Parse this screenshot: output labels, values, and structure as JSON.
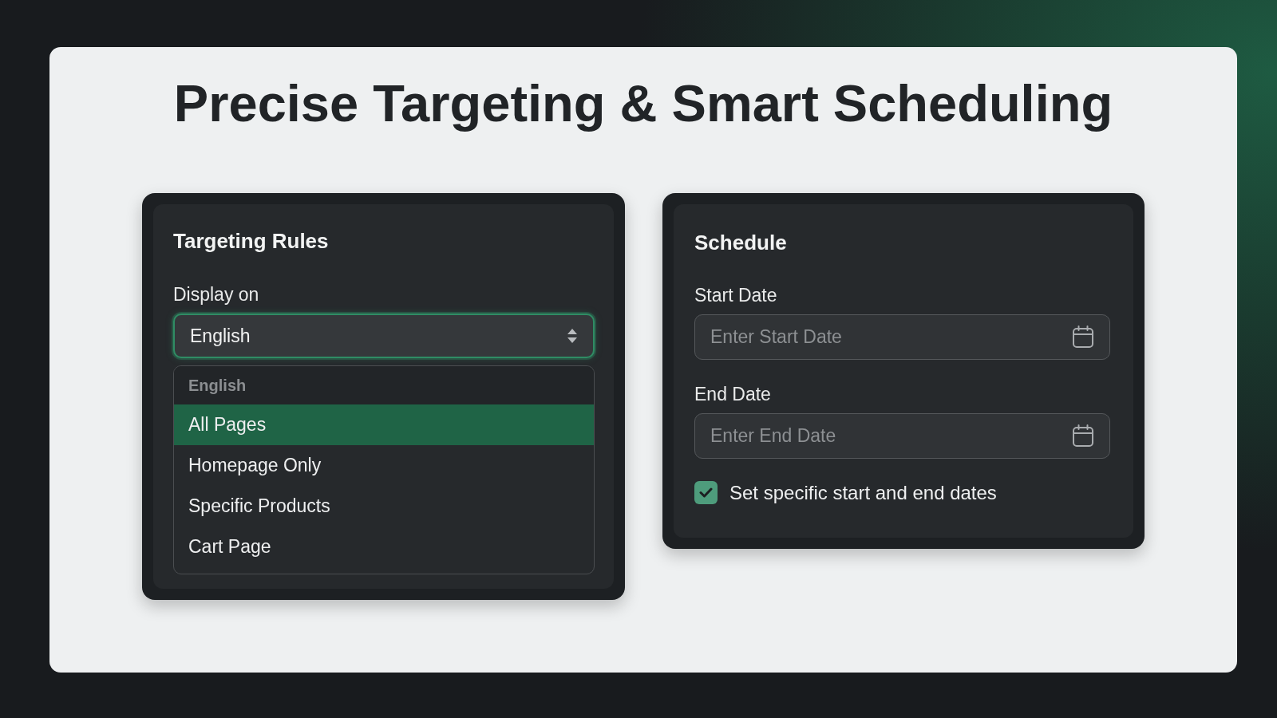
{
  "title": "Precise Targeting & Smart Scheduling",
  "targeting_panel": {
    "heading": "Targeting Rules",
    "label": "Display on",
    "select": {
      "value": "English",
      "expanded": true
    },
    "dropdown": {
      "header": "English",
      "options": [
        {
          "label": "All Pages",
          "selected": true
        },
        {
          "label": "Homepage Only",
          "selected": false
        },
        {
          "label": "Specific Products",
          "selected": false
        },
        {
          "label": "Cart Page",
          "selected": false
        }
      ]
    }
  },
  "schedule_panel": {
    "heading": "Schedule",
    "fields": [
      {
        "label": "Start Date",
        "placeholder": "Enter Start Date"
      },
      {
        "label": "End Date",
        "placeholder": "Enter End Date"
      }
    ],
    "checkbox": {
      "label": "Set specific start and end dates",
      "checked": true
    }
  }
}
